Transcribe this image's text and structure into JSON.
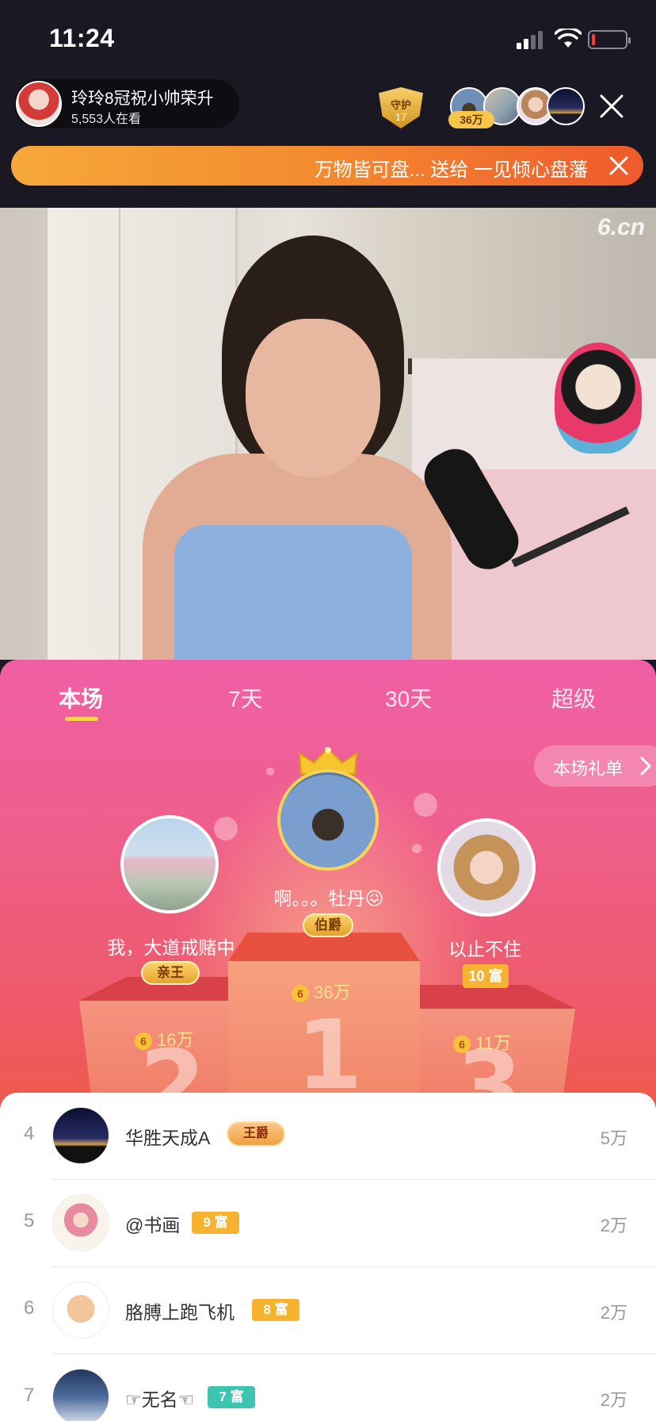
{
  "status_bar": {
    "time": "11:24"
  },
  "host": {
    "name": "玲玲8冠祝小帅荣升",
    "watching": "5,553人在看"
  },
  "guard": {
    "label": "守护",
    "count": "17"
  },
  "viewers": {
    "badge": "36万"
  },
  "banner": {
    "text": "万物皆可盘... 送给 一见倾心盘藩"
  },
  "video": {
    "watermark": "6.cn"
  },
  "tabs": [
    "本场",
    "7天",
    "30天",
    "超级"
  ],
  "gift_list_button": "本场礼单",
  "podium": {
    "first": {
      "name": "啊。。。牡丹😖",
      "title": "伯爵",
      "score": "36万",
      "rank": "1"
    },
    "second": {
      "name": "我，大道戒赌中",
      "title": "亲王",
      "score": "16万",
      "rank": "2"
    },
    "third": {
      "name": "以止不住",
      "title": "10 富",
      "score": "11万",
      "rank": "3"
    }
  },
  "coin_icon_text": "6",
  "list": [
    {
      "rank": "4",
      "name": "华胜天成A",
      "badge": "王爵",
      "value": "5万"
    },
    {
      "rank": "5",
      "name": "@书画",
      "badge": "9 富",
      "value": "2万"
    },
    {
      "rank": "6",
      "name": "胳膊上跑飞机",
      "badge": "8 富",
      "value": "2万"
    },
    {
      "rank": "7",
      "name": "☞无名☜",
      "badge": "7 富",
      "value": "2万"
    }
  ],
  "colors": {
    "panel_pink": "#f05fa5",
    "panel_red": "#ee5a4a",
    "gold": "#f8d45a",
    "rich_orange": "#f7b230",
    "rich_teal": "#3cc5b0"
  }
}
